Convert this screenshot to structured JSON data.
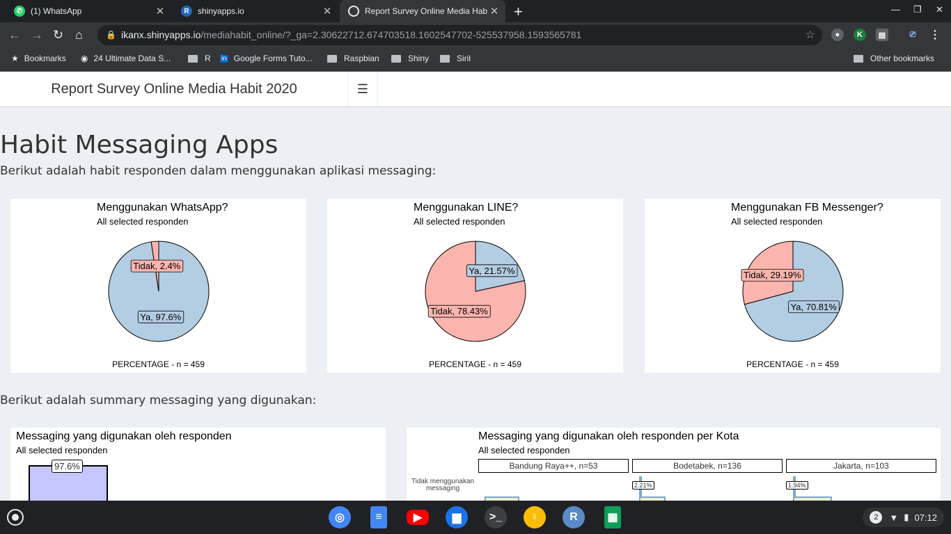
{
  "browser": {
    "tabs": [
      {
        "title": "(1) WhatsApp",
        "icon": "whatsapp-icon"
      },
      {
        "title": "shinyapps.io",
        "icon": "r-logo-icon"
      },
      {
        "title": "Report Survey Online Media Habit",
        "icon": "globe-icon",
        "active": true
      }
    ],
    "url_host": "ikanx.shinyapps.io",
    "url_path": "/mediahabit_online/?_ga=2.30622712.674703518.1602547702-525537958.1593565781",
    "bookmarks": [
      "Bookmarks",
      "24 Ultimate Data S...",
      "R",
      "Google Forms Tuto...",
      "Raspbian",
      "Shiny",
      "Siril"
    ],
    "other_bookmarks": "Other bookmarks"
  },
  "app": {
    "header_title": "Report Survey Online Media Habit 2020",
    "page_title": "Habit Messaging Apps",
    "intro": "Berikut adalah habit responden dalam menggunakan aplikasi messaging:",
    "summary_intro": "Berikut adalah summary messaging yang digunakan:"
  },
  "pies": [
    {
      "title": "Menggunakan WhatsApp?",
      "subtitle": "All selected responden",
      "footer": "PERCENTAGE - n = 459"
    },
    {
      "title": "Menggunakan LINE?",
      "subtitle": "All selected responden",
      "footer": "PERCENTAGE - n = 459"
    },
    {
      "title": "Menggunakan FB Messenger?",
      "subtitle": "All selected responden",
      "footer": "PERCENTAGE - n = 459"
    }
  ],
  "chart_data": [
    {
      "type": "pie",
      "title": "Menggunakan WhatsApp?",
      "subtitle": "All selected responden",
      "xlabel": "PERCENTAGE - n = 459",
      "slices": [
        {
          "label": "Ya, 97.6%",
          "value": 97.6,
          "color": "#b3cde3"
        },
        {
          "label": "Tidak, 2.4%",
          "value": 2.4,
          "color": "#fbb4ae"
        }
      ]
    },
    {
      "type": "pie",
      "title": "Menggunakan LINE?",
      "subtitle": "All selected responden",
      "xlabel": "PERCENTAGE - n = 459",
      "slices": [
        {
          "label": "Ya, 21.57%",
          "value": 21.57,
          "color": "#b3cde3"
        },
        {
          "label": "Tidak, 78.43%",
          "value": 78.43,
          "color": "#fbb4ae"
        }
      ]
    },
    {
      "type": "pie",
      "title": "Menggunakan FB Messenger?",
      "subtitle": "All selected responden",
      "xlabel": "PERCENTAGE - n = 459",
      "slices": [
        {
          "label": "Ya, 70.81%",
          "value": 70.81,
          "color": "#b3cde3"
        },
        {
          "label": "Tidak, 29.19%",
          "value": 29.19,
          "color": "#fbb4ae"
        }
      ]
    },
    {
      "type": "bar",
      "title": "Messaging yang digunakan oleh responden",
      "subtitle": "All selected responden",
      "values": [
        97.6
      ],
      "data_labels": [
        "97.6%"
      ],
      "color": "#c6c6ff"
    },
    {
      "type": "bar",
      "title": "Messaging yang digunakan oleh responden per Kota",
      "subtitle": "All selected responden",
      "facets": [
        "Bandung Raya++, n=53",
        "Bodetabek, n=136",
        "Jakarta, n=103"
      ],
      "categories": [
        "Tidak menggunakan messaging"
      ],
      "data_labels": [
        "2.21%",
        "1.94%"
      ]
    }
  ],
  "summary": {
    "bar": {
      "title": "Messaging yang digunakan oleh responden",
      "subtitle": "All selected responden",
      "label": "97.6%"
    },
    "facet": {
      "title": "Messaging yang digunakan oleh responden per Kota",
      "subtitle": "All selected responden",
      "facets": [
        "Bandung Raya++, n=53",
        "Bodetabek, n=136",
        "Jakarta, n=103"
      ],
      "row_label": "Tidak menggunakan messaging",
      "labels": [
        "2.21%",
        "1.94%"
      ]
    }
  },
  "system": {
    "notifications": "2",
    "time": "07:12"
  }
}
